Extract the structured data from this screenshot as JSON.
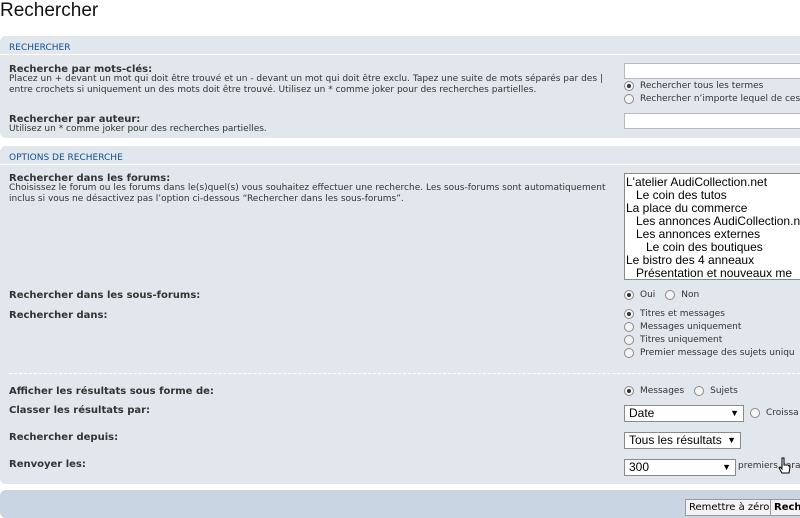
{
  "page": {
    "title": "Rechercher"
  },
  "section_search": {
    "header": "Rechercher",
    "keywords": {
      "label": "Recherche par mots-clés:",
      "description": "Placez un + devant un mot qui doit être trouvé et un - devant un mot qui doit être exclu. Tapez une suite de mots séparés par des | entre crochets si uniquement un des mots doit être trouvé. Utilisez un * comme joker pour des recherches partielles.",
      "value": "",
      "options": [
        {
          "label": "Rechercher tous les termes",
          "checked": true
        },
        {
          "label": "Rechercher n’importe lequel de ces",
          "checked": false
        }
      ]
    },
    "author": {
      "label": "Rechercher par auteur:",
      "description": "Utilisez un * comme joker pour des recherches partielles.",
      "value": ""
    }
  },
  "section_options": {
    "header": "Options de recherche",
    "forums": {
      "label": "Rechercher dans les forums:",
      "description": "Choisissez le forum ou les forums dans le(s)quel(s) vous souhaitez effectuer une recherche. Les sous-forums sont automatiquement inclus si vous ne désactivez pas l’option ci-dessous “Rechercher dans les sous-forums”.",
      "items": [
        "L'atelier AudiCollection.net",
        "   Le coin des tutos",
        "La place du commerce",
        "   Les annonces AudiCollection.n",
        "   Les annonces externes",
        "      Le coin des boutiques",
        "Le bistro des 4 anneaux",
        "   Présentation et nouveaux me"
      ]
    },
    "subforums": {
      "label": "Rechercher dans les sous-forums:",
      "options": [
        {
          "label": "Oui",
          "checked": true
        },
        {
          "label": "Non",
          "checked": false
        }
      ]
    },
    "search_in": {
      "label": "Rechercher dans:",
      "options": [
        {
          "label": "Titres et messages",
          "checked": true
        },
        {
          "label": "Messages uniquement",
          "checked": false
        },
        {
          "label": "Titres uniquement",
          "checked": false
        },
        {
          "label": "Premier message des sujets uniqu",
          "checked": false
        }
      ]
    },
    "display_as": {
      "label": "Afficher les résultats sous forme de:",
      "options": [
        {
          "label": "Messages",
          "checked": true
        },
        {
          "label": "Sujets",
          "checked": false
        }
      ]
    },
    "sort_by": {
      "label": "Classer les résultats par:",
      "selected": "Date",
      "order_label": "Croissa"
    },
    "since": {
      "label": "Rechercher depuis:",
      "selected": "Tous les résultats"
    },
    "return": {
      "label": "Renvoyer les:",
      "selected": "300",
      "suffix": "premiers cara"
    }
  },
  "footer": {
    "reset_label": "Remettre à zéro",
    "submit_label": "Rech"
  }
}
